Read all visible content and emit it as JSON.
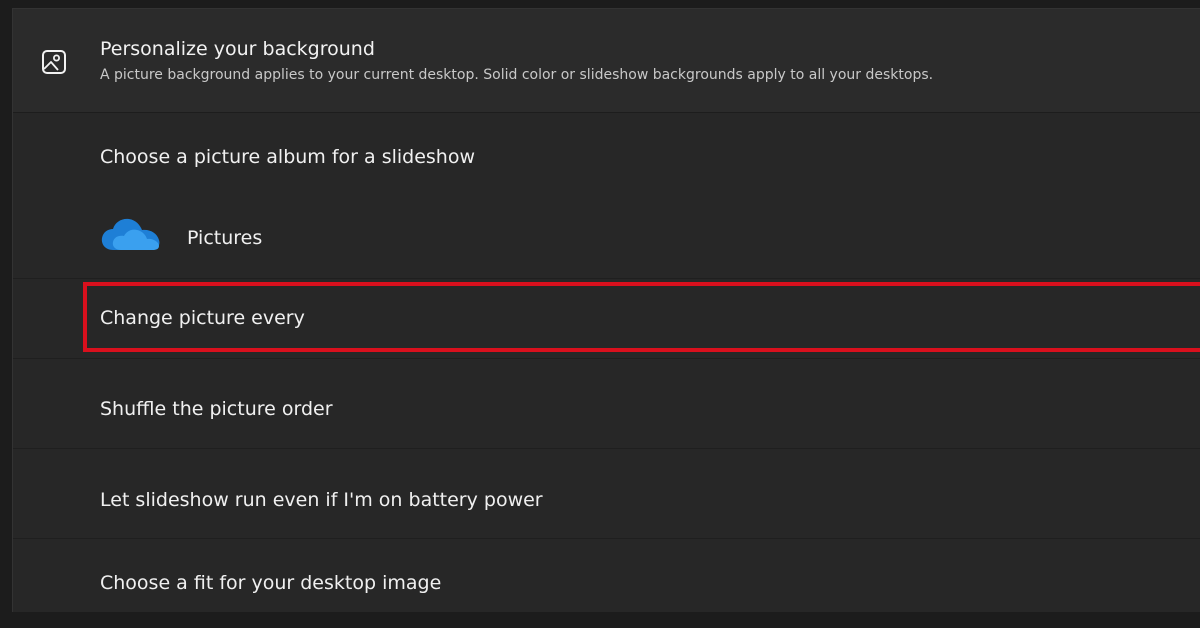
{
  "header": {
    "icon": "image-icon",
    "title": "Personalize your background",
    "subtitle": "A picture background applies to your current desktop. Solid color or slideshow backgrounds apply to all your desktops."
  },
  "album": {
    "label": "Choose a picture album for a slideshow",
    "folder_icon": "onedrive-cloud-icon",
    "folder_name": "Pictures"
  },
  "settings": {
    "change_picture": "Change picture every",
    "shuffle": "Shuffle the picture order",
    "battery": "Let slideshow run even if I'm on battery power",
    "fit": "Choose a fit for your desktop image"
  },
  "colors": {
    "highlight": "#d9101d",
    "cloud": "#1e7fd6",
    "panel": "#272727"
  }
}
